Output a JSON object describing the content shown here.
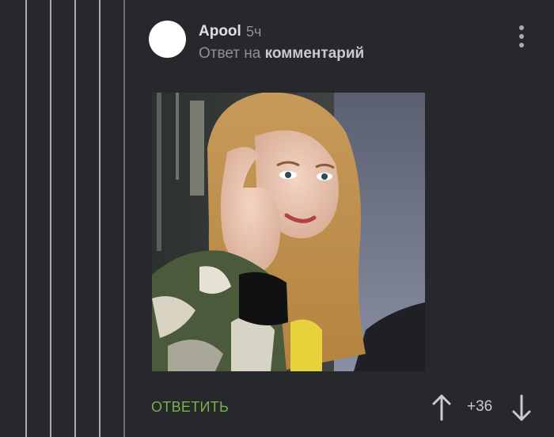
{
  "comment": {
    "author": "Apool",
    "time": "5ч",
    "reply_prefix": "Ответ на",
    "reply_target": "комментарий",
    "reply_label": "ОТВЕТИТЬ",
    "rating": "+36"
  },
  "colors": {
    "background": "#26282c",
    "accent_green": "#78b04b",
    "thread_line": "#a9abad"
  },
  "icons": {
    "more": "more-vertical-icon",
    "upvote": "arrow-up-icon",
    "downvote": "arrow-down-icon"
  }
}
